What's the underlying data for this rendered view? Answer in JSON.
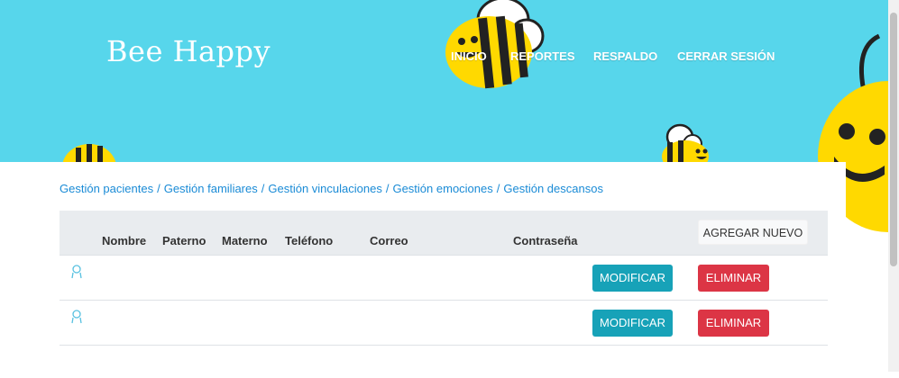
{
  "app": {
    "brand": "Bee Happy"
  },
  "nav": {
    "items": [
      "INICIO",
      "REPORTES",
      "RESPALDO",
      "CERRAR SESIÓN"
    ]
  },
  "breadcrumb": {
    "items": [
      "Gestión pacientes",
      "Gestión familiares",
      "Gestión vinculaciones",
      "Gestión emociones",
      "Gestión descansos"
    ],
    "separator": "/"
  },
  "table": {
    "columns": [
      "Nombre",
      "Paterno",
      "Materno",
      "Teléfono",
      "Correo",
      "Contraseña"
    ],
    "add_label": "AGREGAR NUEVO",
    "rows": [
      {
        "icon": "user-icon",
        "modify_label": "MODIFICAR",
        "delete_label": "ELIMINAR"
      },
      {
        "icon": "user-icon",
        "modify_label": "MODIFICAR",
        "delete_label": "ELIMINAR"
      }
    ]
  },
  "colors": {
    "header_bg": "#57d6eb",
    "modify": "#17a2b8",
    "delete": "#dc3545",
    "link": "#1a8bd6",
    "bee_yellow": "#ffd900"
  }
}
